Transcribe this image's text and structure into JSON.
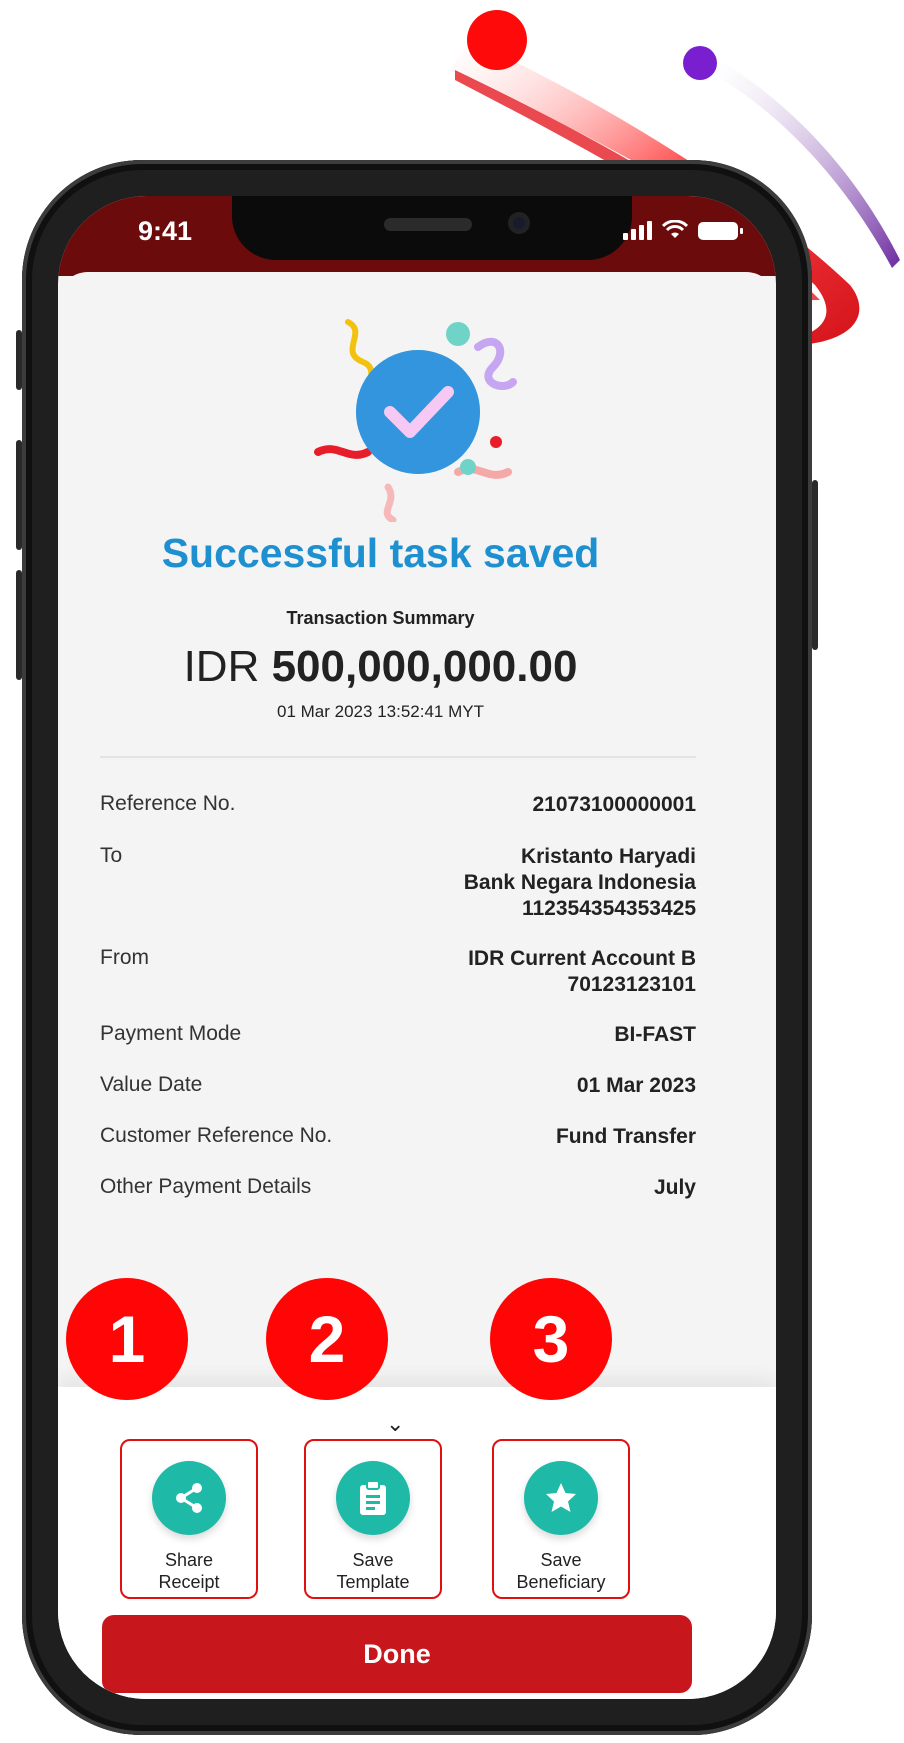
{
  "statusbar": {
    "time": "9:41"
  },
  "header": {
    "title": "Successful task saved",
    "summary_label": "Transaction Summary",
    "currency": "IDR",
    "amount": "500,000,000.00",
    "timestamp": "01 Mar 2023 13:52:41 MYT"
  },
  "details": {
    "rows": [
      {
        "label": "Reference No.",
        "value": [
          "21073100000001"
        ]
      },
      {
        "label": "To",
        "value": [
          "Kristanto Haryadi",
          "Bank Negara Indonesia",
          "112354354353425"
        ]
      },
      {
        "label": "From",
        "value": [
          "IDR Current Account B",
          "70123123101"
        ]
      },
      {
        "label": "Payment Mode",
        "value": [
          "BI-FAST"
        ]
      },
      {
        "label": "Value Date",
        "value": [
          "01 Mar 2023"
        ]
      },
      {
        "label": "Customer Reference No.",
        "value": [
          "Fund Transfer"
        ]
      },
      {
        "label": "Other Payment Details",
        "value": [
          "July"
        ]
      }
    ]
  },
  "actions": {
    "share": {
      "line1": "Share",
      "line2": "Receipt",
      "icon": "share-icon"
    },
    "template": {
      "line1": "Save",
      "line2": "Template",
      "icon": "clipboard-icon"
    },
    "beneficiary": {
      "line1": "Save",
      "line2": "Beneficiary",
      "icon": "star-icon"
    }
  },
  "done_label": "Done",
  "markers": [
    "1",
    "2",
    "3"
  ],
  "colors": {
    "title_blue": "#1e90d0",
    "brand_red": "#c8161d",
    "marker_red": "#ff0505",
    "action_teal": "#1fb9a8",
    "statusbar": "#6b0b0b"
  }
}
